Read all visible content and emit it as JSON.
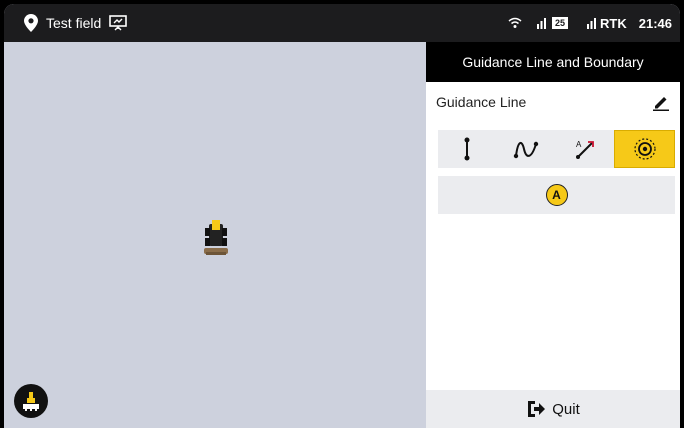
{
  "statusbar": {
    "field_name": "Test field",
    "battery": "25",
    "signal_label": "RTK",
    "time": "21:46",
    "icons": [
      "location-pin-icon",
      "presentation-icon",
      "wifi-icon",
      "cellular-icon",
      "battery-icon",
      "rtk-signal-icon"
    ]
  },
  "panel": {
    "header": "Guidance Line and Boundary",
    "section_label": "Guidance Line",
    "modes": [
      "straight-line-icon",
      "curve-line-icon",
      "ab-heading-icon",
      "pivot-circle-icon"
    ],
    "active_mode": "pivot-circle-icon",
    "point_label": "A",
    "quit_label": "Quit"
  },
  "colors": {
    "accent": "#f6c918",
    "statusbar_bg": "#1c1c1e",
    "map_bg": "#cdd1dd"
  }
}
